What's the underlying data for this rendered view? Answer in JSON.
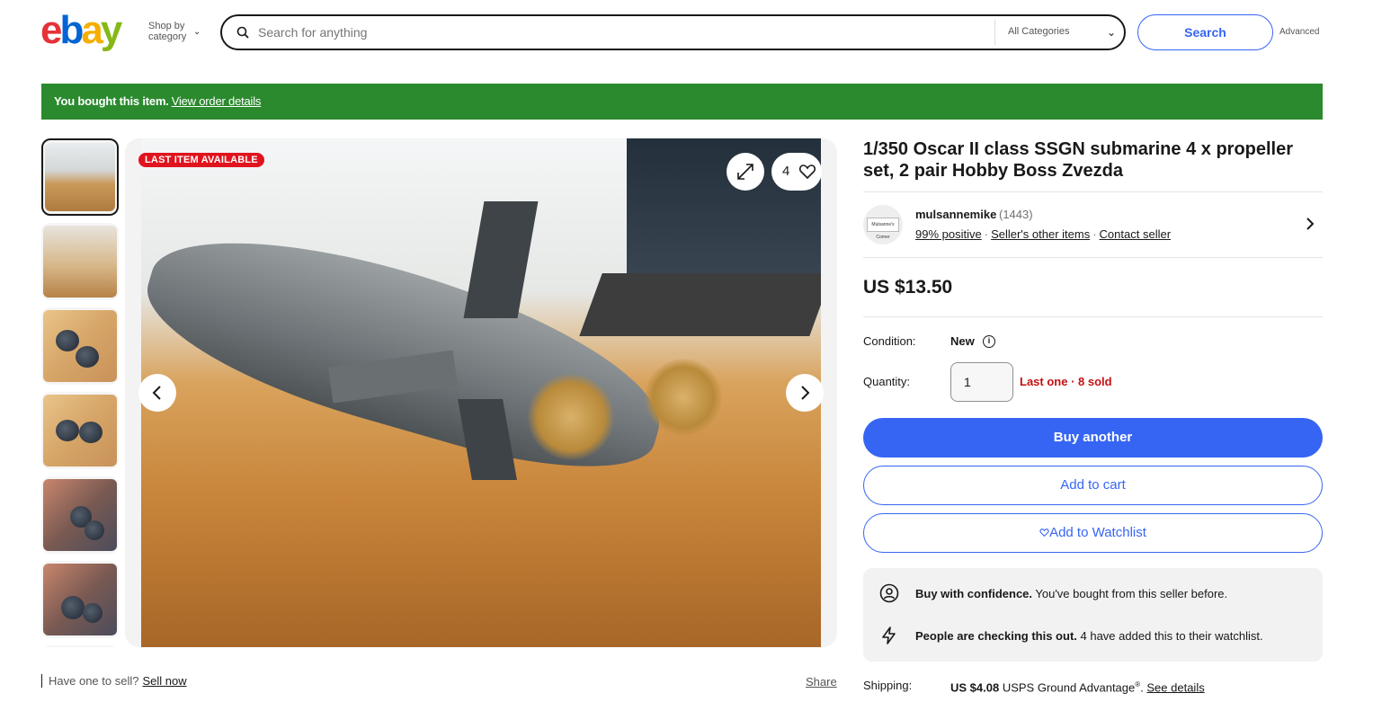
{
  "header": {
    "logo": {
      "e": "e",
      "b": "b",
      "a": "a",
      "y": "y"
    },
    "shop_by_line1": "Shop by",
    "shop_by_line2": "category",
    "search_placeholder": "Search for anything",
    "category_select": "All Categories",
    "search_button": "Search",
    "advanced_link": "Advanced"
  },
  "banner": {
    "message": "You bought this item.",
    "link": "View order details",
    "color": "#2b8a2e"
  },
  "gallery": {
    "badge": "LAST ITEM AVAILABLE",
    "watch_count": "4",
    "thumbnail_count": 6
  },
  "sell_bar": {
    "prompt": "Have one to sell?",
    "link": "Sell now",
    "share": "Share"
  },
  "listing": {
    "title": "1/350 Oscar II class SSGN submarine 4 x propeller set, 2 pair Hobby Boss Zvezda",
    "seller": {
      "name": "mulsannemike",
      "feedback_count": "(1443)",
      "positive": "99% positive",
      "other_items": "Seller's other items",
      "contact": "Contact seller",
      "avatar_text": "Mulsanne's Corner"
    },
    "price": "US $13.50",
    "condition_label": "Condition:",
    "condition_value": "New",
    "quantity_label": "Quantity:",
    "quantity_value": "1",
    "quantity_note": "Last one · 8 sold",
    "buttons": {
      "buy": "Buy another",
      "cart": "Add to cart",
      "watchlist": "Add to Watchlist"
    },
    "confidence": [
      {
        "icon": "person-check-icon",
        "bold": "Buy with confidence.",
        "text": " You've bought from this seller before."
      },
      {
        "icon": "lightning-icon",
        "bold": "People are checking this out.",
        "text": " 4 have added this to their watchlist."
      }
    ],
    "shipping_label": "Shipping:",
    "shipping_price": "US $4.08",
    "shipping_service": " USPS Ground Advantage",
    "shipping_reg": "®",
    "shipping_sep": ". ",
    "shipping_link": "See details",
    "accent_color": "#3665f3",
    "urgent_color": "#c41010"
  }
}
